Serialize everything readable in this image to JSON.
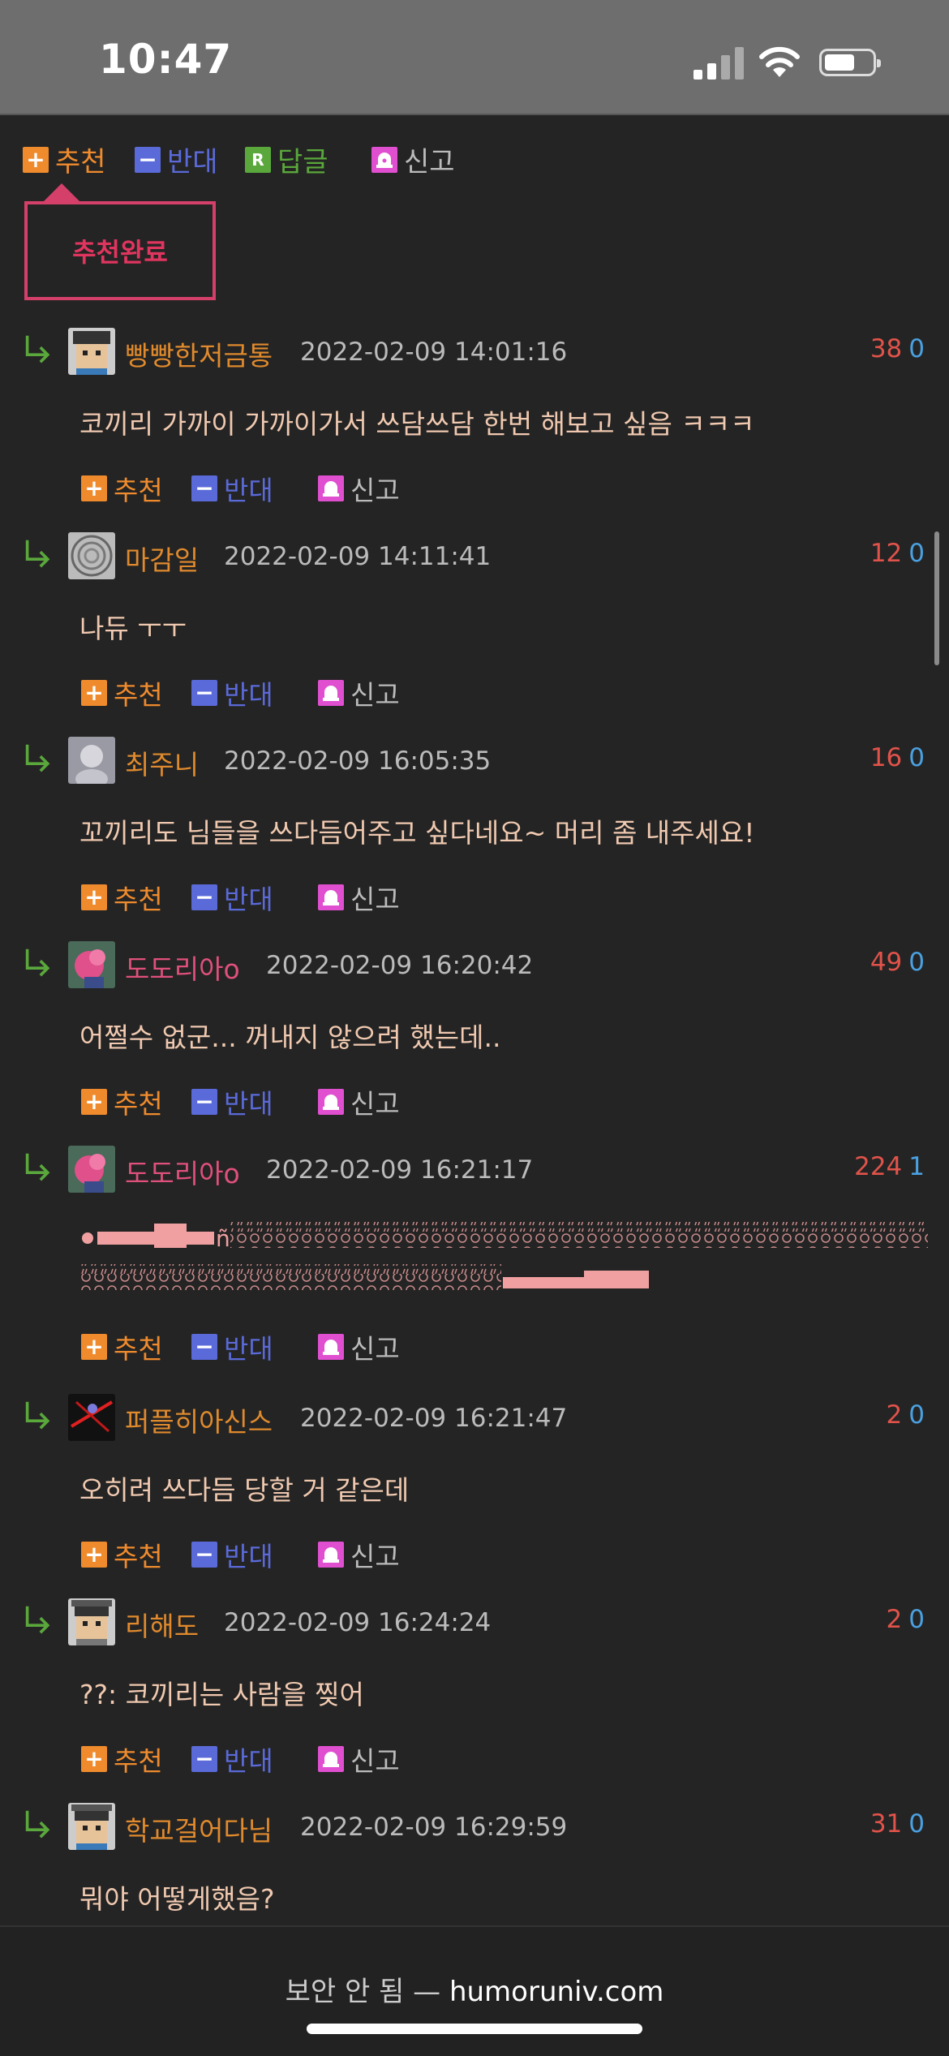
{
  "status_bar": {
    "time": "10:47"
  },
  "top_actions": {
    "recommend": "추천",
    "oppose": "반대",
    "reply": "답글",
    "report": "신고"
  },
  "popup": {
    "text": "추천완료"
  },
  "action_labels": {
    "recommend": "추천",
    "oppose": "반대",
    "report": "신고"
  },
  "comments": [
    {
      "nick": "빵빵한저금통",
      "date": "2022-02-09 14:01:16",
      "up": "38",
      "down": "0",
      "text": "코끼리 가까이 가까이가서 쓰담쓰담 한번 해보고 싶음 ㅋㅋㅋ"
    },
    {
      "nick": "마감일",
      "date": "2022-02-09 14:11:41",
      "up": "12",
      "down": "0",
      "text": "나듀 ㅜㅜ"
    },
    {
      "nick": "최주니",
      "date": "2022-02-09 16:05:35",
      "up": "16",
      "down": "0",
      "text": "꼬끼리도 님들을 쓰다듬어주고 싶다네요~ 머리 좀 내주세요!"
    },
    {
      "nick": "도도리아o",
      "date": "2022-02-09 16:20:42",
      "up": "49",
      "down": "0",
      "text": "어쩔수 없군... 꺼내지 않으려 했는데.."
    },
    {
      "nick": "도도리아o",
      "date": "2022-02-09 16:21:17",
      "up": "224",
      "down": "1",
      "text": ""
    },
    {
      "nick": "퍼플히아신스",
      "date": "2022-02-09 16:21:47",
      "up": "2",
      "down": "0",
      "text": "오히려 쓰다듬 당할 거 같은데"
    },
    {
      "nick": "리해도",
      "date": "2022-02-09 16:24:24",
      "up": "2",
      "down": "0",
      "text": "??: 코끼리는 사람을 찢어"
    },
    {
      "nick": "학교걸어다님",
      "date": "2022-02-09 16:29:59",
      "up": "31",
      "down": "0",
      "text": "뭐야 어떻게했음?"
    }
  ],
  "footer": {
    "security": "보안 안 됨 —",
    "domain": "humoruniv.com"
  }
}
